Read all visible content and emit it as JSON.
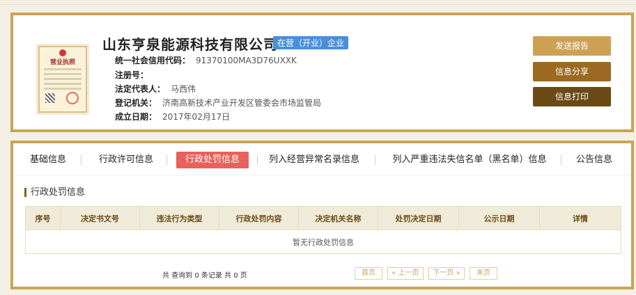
{
  "company": {
    "name": "山东亨泉能源科技有限公司",
    "status": "在营（开业）企业",
    "license_title": "营业执照",
    "fields": [
      {
        "label": "统一社会信用代码：",
        "value": "91370100MA3D76UXXK"
      },
      {
        "label": "注册号：",
        "value": ""
      },
      {
        "label": "法定代表人：",
        "value": "马西伟"
      },
      {
        "label": "登记机关：",
        "value": "济南高新技术产业开发区管委会市场监管局"
      },
      {
        "label": "成立日期：",
        "value": "2017年02月17日"
      }
    ]
  },
  "actions": {
    "report": "发送报告",
    "share": "信息分享",
    "print": "信息打印"
  },
  "tabs": [
    "基础信息",
    "行政许可信息",
    "行政处罚信息",
    "列入经营异常名录信息",
    "列入严重违法失信名单（黑名单）信息",
    "公告信息"
  ],
  "active_tab": "行政处罚信息",
  "section": {
    "title": "行政处罚信息",
    "columns": [
      "序号",
      "决定书文号",
      "违法行为类型",
      "行政处罚内容",
      "决定机关名称",
      "处罚决定日期",
      "公示日期",
      "详情"
    ],
    "empty_text": "暂无行政处罚信息"
  },
  "pagination": {
    "summary": "共 查询到 0 条记录 共 0 页",
    "first": "首页",
    "prev": "« 上一页",
    "next": "下一页 »",
    "last": "末页"
  },
  "colors": {
    "border": "#c9a552",
    "active_tab": "#e8615a",
    "status_badge": "#4a90d9",
    "btn_report": "#cda154",
    "btn_share": "#9c6a23",
    "btn_print": "#6b4a16"
  }
}
